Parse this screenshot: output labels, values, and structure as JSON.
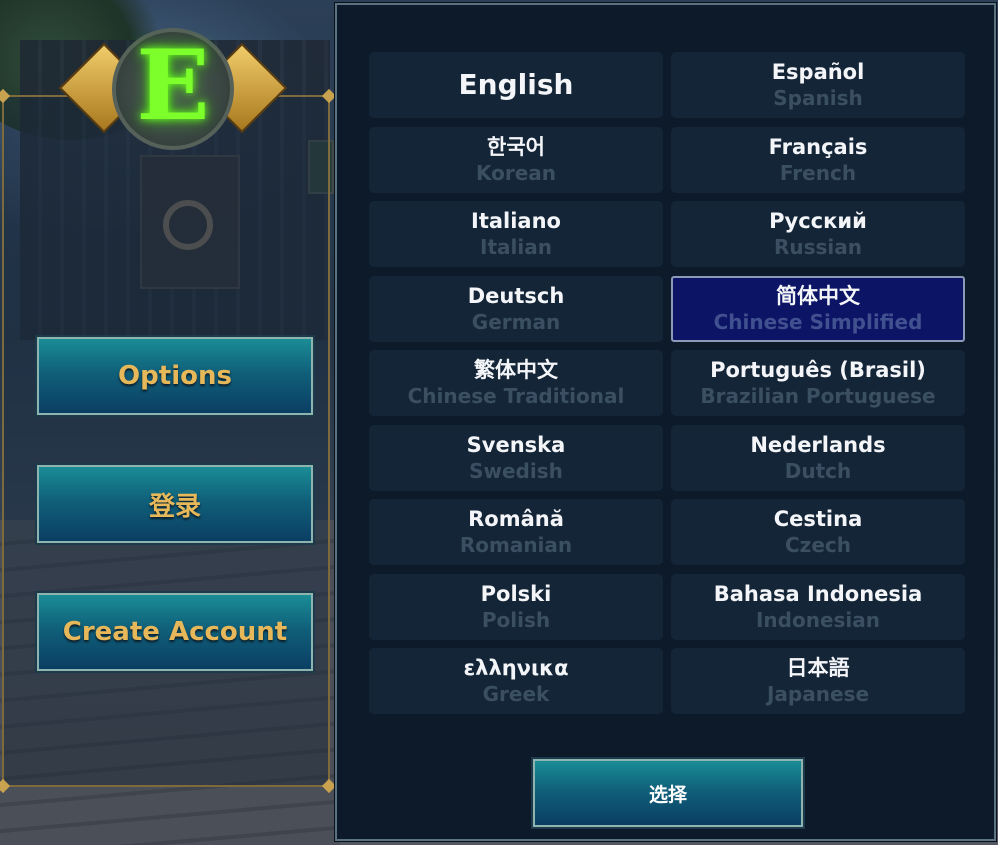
{
  "left_menu": {
    "options_label": "Options",
    "login_label": "登录",
    "create_account_label": "Create Account"
  },
  "emblem": {
    "glyph": "E",
    "icon": "glowing-green-e-emblem"
  },
  "language_dialog": {
    "languages": [
      {
        "native": "English",
        "english": ""
      },
      {
        "native": "Español",
        "english": "Spanish"
      },
      {
        "native": "한국어",
        "english": "Korean"
      },
      {
        "native": "Français",
        "english": "French"
      },
      {
        "native": "Italiano",
        "english": "Italian"
      },
      {
        "native": "Русский",
        "english": "Russian"
      },
      {
        "native": "Deutsch",
        "english": "German"
      },
      {
        "native": "简体中文",
        "english": "Chinese Simplified"
      },
      {
        "native": "繁体中文",
        "english": "Chinese Traditional"
      },
      {
        "native": "Português (Brasil)",
        "english": "Brazilian Portuguese"
      },
      {
        "native": "Svenska",
        "english": "Swedish"
      },
      {
        "native": "Nederlands",
        "english": "Dutch"
      },
      {
        "native": "Română",
        "english": "Romanian"
      },
      {
        "native": "Cestina",
        "english": "Czech"
      },
      {
        "native": "Polski",
        "english": "Polish"
      },
      {
        "native": "Bahasa Indonesia",
        "english": "Indonesian"
      },
      {
        "native": "ελληνικα",
        "english": "Greek"
      },
      {
        "native": "日本語",
        "english": "Japanese"
      }
    ],
    "selected_language": "简体中文",
    "select_button_label": "选择"
  },
  "colors": {
    "accent_teal": "#10607a",
    "selected_bg": "#0c1466",
    "tile_bg": "#142537",
    "button_text_gold": "#e6b85a"
  }
}
